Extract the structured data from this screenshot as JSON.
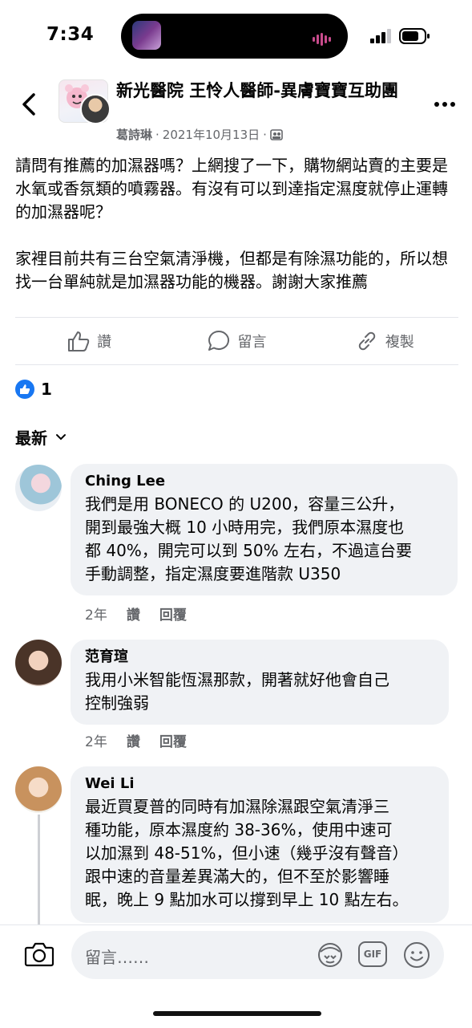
{
  "status": {
    "time": "7:34"
  },
  "header": {
    "group_title": "新光醫院 王怜人醫師-異膚寶寶互助團",
    "author": "葛詩琳",
    "date": "2021年10月13日",
    "separator": "·"
  },
  "post": {
    "paragraphs": [
      "請問有推薦的加濕器嗎？上網搜了一下，購物網站賣的主要是水氧或香氛類的噴霧器。有沒有可以到達指定濕度就停止運轉的加濕器呢？",
      "家裡目前共有三台空氣清淨機，但都是有除濕功能的，所以想找一台單純就是加濕器功能的機器。謝謝大家推薦"
    ]
  },
  "actions": {
    "like": "讚",
    "comment": "留言",
    "copy": "複製"
  },
  "reactions": {
    "count": "1"
  },
  "sort": {
    "label": "最新"
  },
  "comments": [
    {
      "name": "Ching Lee",
      "lines": [
        "我們是用 BONECO 的 U200，容量三公升，",
        "開到最強大概 10 小時用完，我們原本濕度也",
        "都 40%，開完可以到 50% 左右，不過這台要",
        "手動調整，指定濕度要進階款 U350"
      ],
      "time": "2年",
      "like": "讚",
      "reply": "回覆"
    },
    {
      "name": "范育瑄",
      "lines": [
        "我用小米智能恆濕那款，開著就好他會自己",
        "控制強弱"
      ],
      "time": "2年",
      "like": "讚",
      "reply": "回覆"
    },
    {
      "name": "Wei Li",
      "lines": [
        "最近買夏普的同時有加濕除濕跟空氣清淨三",
        "種功能，原本濕度約 38-36%，使用中速可",
        "以加濕到 48-51%，但小速（幾乎沒有聲音）",
        "跟中速的音量差異滿大的，但不至於影響睡",
        "眠，晚上 9 點加水可以撐到早上 10 點左右。"
      ]
    }
  ],
  "composer": {
    "placeholder": "留言……",
    "gif_label": "GIF"
  },
  "colors": {
    "accent": "#1877f2",
    "bubble": "#f0f2f5",
    "muted": "#65676b"
  }
}
